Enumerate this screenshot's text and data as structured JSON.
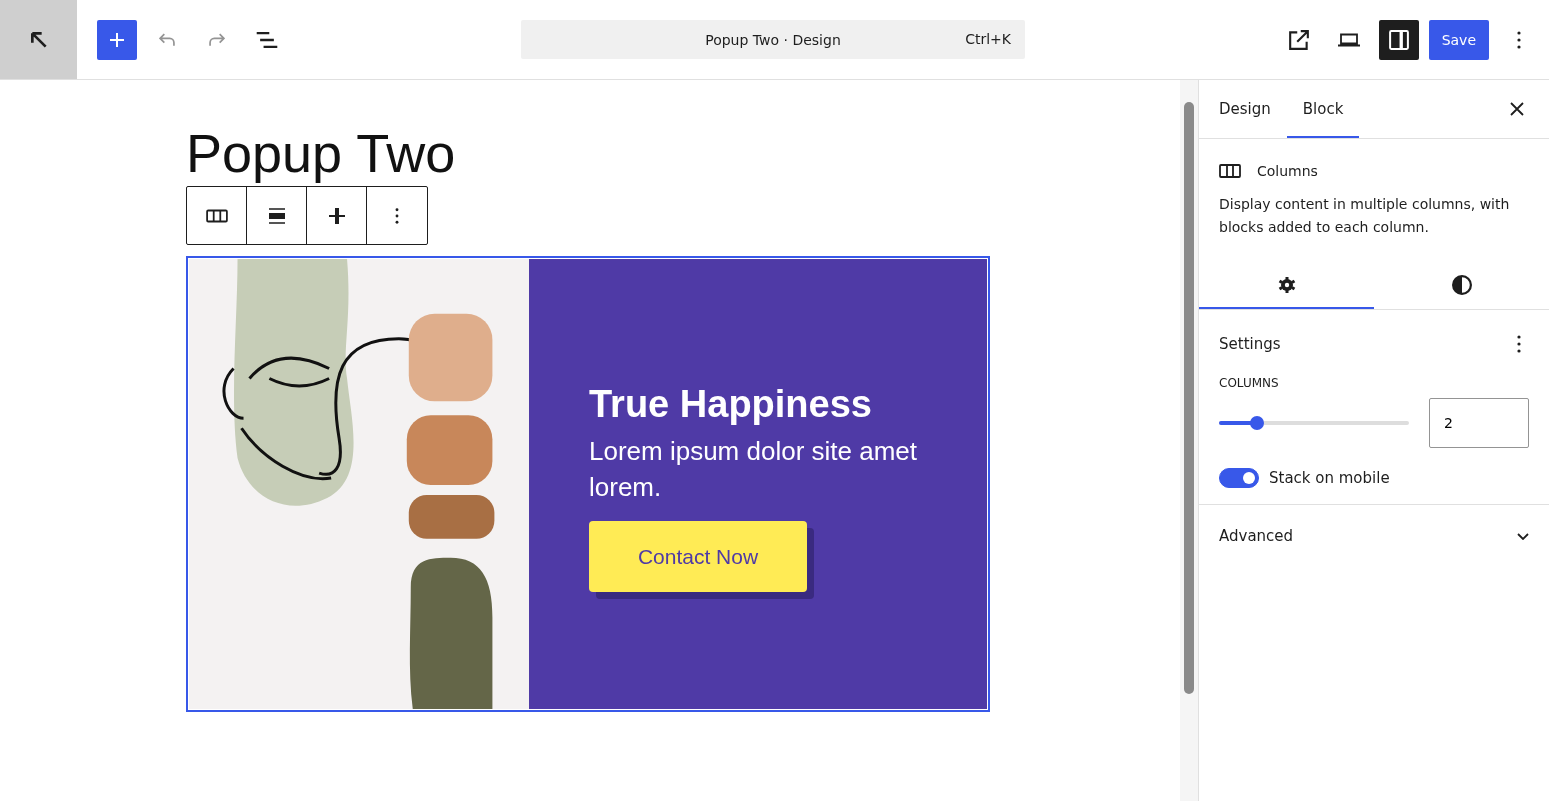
{
  "topbar": {
    "command": "Popup Two · Design",
    "shortcut": "Ctrl+K",
    "sidebar_toggle": {
      "pressed": true
    },
    "save": "Save"
  },
  "canvas": {
    "title": "Popup Two",
    "hero": {
      "heading": "True Happiness",
      "text": "Lorem ipsum dolor site amet lorem.",
      "button": "Contact Now"
    }
  },
  "sidebar": {
    "tabs": [
      {
        "label": "Design",
        "selected": false
      },
      {
        "label": "Block",
        "selected": true
      }
    ],
    "block": {
      "name": "Columns",
      "description": "Display content in multiple columns, with blocks added to each column."
    },
    "subtabs": [
      {
        "kind": "settings",
        "selected": true
      },
      {
        "kind": "styles",
        "selected": false
      }
    ],
    "settings": {
      "title": "Settings",
      "columns_label": "COLUMNS",
      "level": 0.2,
      "value": "2",
      "toggle": {
        "label": "Stack on mobile",
        "on": true
      }
    },
    "advanced": {
      "label": "Advanced",
      "expanded": false
    }
  }
}
